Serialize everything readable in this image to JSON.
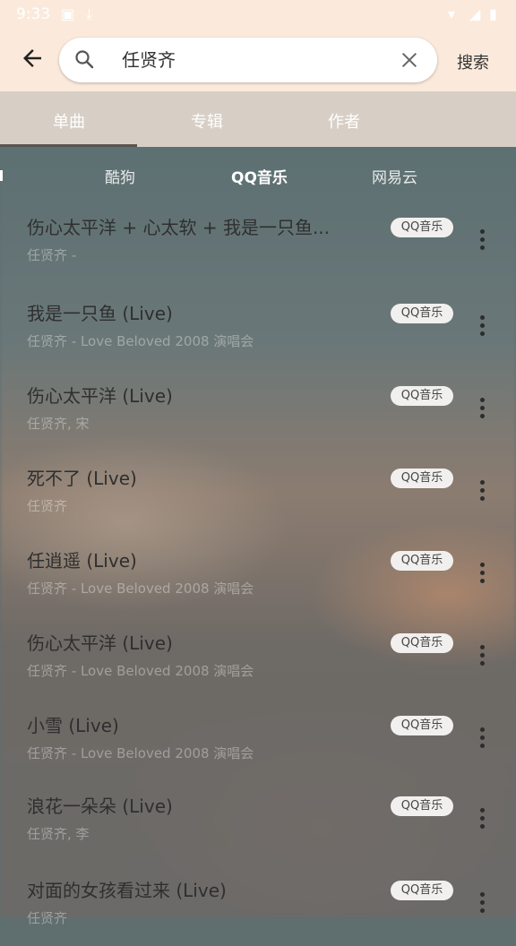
{
  "status": {
    "time": "9:33"
  },
  "header": {
    "search_value": "任贤齐",
    "search_button": "搜索"
  },
  "tabs": [
    {
      "label": "单曲"
    },
    {
      "label": "专辑"
    },
    {
      "label": "作者"
    }
  ],
  "sources": [
    {
      "label": "酷狗"
    },
    {
      "label": "QQ音乐"
    },
    {
      "label": "网易云"
    }
  ],
  "songs": [
    {
      "title": "伤心太平洋 + 心太软 + 我是一只鱼...",
      "subtitle": "任贤齐 - ",
      "badge": "QQ音乐"
    },
    {
      "title": "我是一只鱼 (Live)",
      "subtitle": "任贤齐 - Love Beloved 2008 演唱会",
      "badge": "QQ音乐"
    },
    {
      "title": "伤心太平洋 (Live)",
      "subtitle": "任贤齐, 宋",
      "badge": "QQ音乐"
    },
    {
      "title": "死不了 (Live)",
      "subtitle": "任贤齐",
      "badge": "QQ音乐"
    },
    {
      "title": "任逍遥 (Live)",
      "subtitle": "任贤齐 - Love Beloved 2008 演唱会",
      "badge": "QQ音乐"
    },
    {
      "title": "伤心太平洋 (Live)",
      "subtitle": "任贤齐 - Love Beloved 2008 演唱会",
      "badge": "QQ音乐"
    },
    {
      "title": "小雪 (Live)",
      "subtitle": "任贤齐 - Love Beloved 2008 演唱会",
      "badge": "QQ音乐"
    },
    {
      "title": "浪花一朵朵 (Live)",
      "subtitle": "任贤齐, 李",
      "badge": "QQ音乐"
    },
    {
      "title": "对面的女孩看过来 (Live)",
      "subtitle": "任贤齐",
      "badge": "QQ音乐"
    }
  ]
}
